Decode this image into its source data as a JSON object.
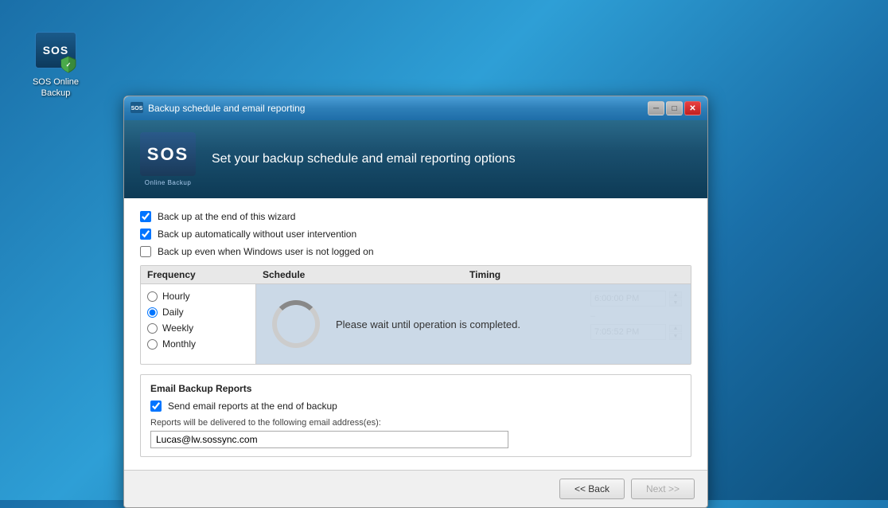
{
  "desktop": {
    "icon_label": "SOS Online\nBackup",
    "icon_sos": "SOS"
  },
  "dialog": {
    "title": "Backup schedule and email reporting",
    "header_title": "Set your backup schedule and email reporting options",
    "logo_text": "SOS",
    "logo_subtitle": "Online Backup",
    "checkboxes": {
      "backup_end": "Back up at the end of this wizard",
      "backup_auto": "Back up automatically without user intervention",
      "backup_loggedoff": "Back up even when Windows user is not logged on"
    },
    "schedule": {
      "col_frequency": "Frequency",
      "col_schedule": "Schedule",
      "col_timing": "Timing",
      "frequency_options": [
        "Hourly",
        "Daily",
        "Weekly",
        "Monthly"
      ],
      "selected_frequency": "Daily"
    },
    "loading": {
      "message": "Please wait until operation is completed."
    },
    "timing": {
      "time1": "6:00:00 PM",
      "time2": "7:05:52 PM"
    },
    "email": {
      "section_title": "Email Backup Reports",
      "send_reports_label": "Send email reports at the end of backup",
      "delivery_note": "Reports will be delivered to the following email address(es):",
      "email_value": "Lucas@lw.sossync.com"
    },
    "buttons": {
      "back": "<< Back",
      "next": "Next >>"
    }
  }
}
